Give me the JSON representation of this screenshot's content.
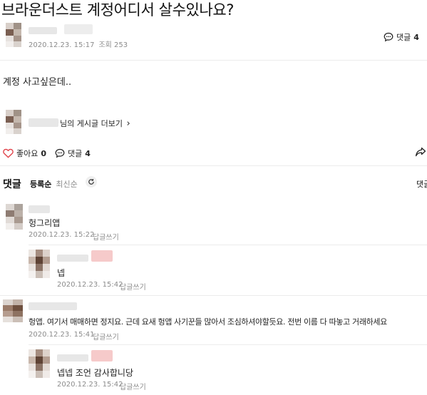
{
  "post": {
    "title": "브라운더스트 계정어디서 살수있나요?",
    "date": "2020.12.23. 15:17",
    "views_label": "조회 253",
    "comment_link_label": "댓글",
    "comment_count": "4",
    "content": "계정 사고싶은데..",
    "more_posts_label": "님의 게시글 더보기",
    "more_posts_chevron": "›",
    "like_label": "좋아요",
    "like_count": "0",
    "comment_label": "댓글",
    "comment_count_bottom": "4"
  },
  "icons": {
    "comment": "speech-bubble-icon",
    "heart": "heart-icon",
    "share": "share-icon",
    "refresh": "refresh-icon"
  },
  "comments_section": {
    "heading": "댓글",
    "sort_registered": "등록순",
    "sort_latest": "최신순",
    "right_cut_label": "댓글"
  },
  "comments": [
    {
      "text": "헝그리앱",
      "date": "2020.12.23. 15:22",
      "reply_label": "답글쓰기"
    },
    {
      "text": "넵",
      "date": "2020.12.23. 15:42",
      "reply_label": "답글쓰기"
    },
    {
      "text": "헝앱. 여기서 매매하면 정지요. 근데 요새 헝앱 사기꾼들 많아서 조심하셔야할듯요. 전번 이름 다 따놓고 거래하세요",
      "date": "2020.12.23. 15:41",
      "reply_label": "답글쓰기"
    },
    {
      "text": "넵넵 조언 감사합니당",
      "date": "2020.12.23. 15:42",
      "reply_label": "답글쓰기"
    }
  ],
  "colors": {
    "heart": "#e0434a",
    "meta_gray": "#8c8c8c",
    "divider": "#ececec",
    "reply_background": "#ffffff"
  }
}
